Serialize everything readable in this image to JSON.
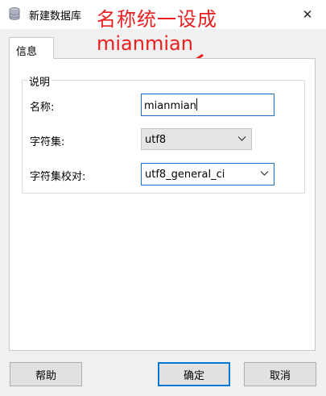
{
  "window": {
    "title": "新建数据库",
    "close_glyph": "✕"
  },
  "annotation": {
    "line1": "名称统一设成",
    "line2": "mianmian",
    "color": "#e8201f"
  },
  "tabs": [
    {
      "label": "信息",
      "active": true
    }
  ],
  "group": {
    "legend": "说明",
    "fields": {
      "name": {
        "label": "名称:",
        "value": "mianmian"
      },
      "charset": {
        "label": "字符集:",
        "value": "utf8"
      },
      "collation": {
        "label": "字符集校对:",
        "value": "utf8_general_ci"
      }
    }
  },
  "buttons": {
    "help": "帮助",
    "ok": "确定",
    "cancel": "取消"
  },
  "icons": {
    "title": "database-icon",
    "dropdown": "chevron-down-icon"
  },
  "colors": {
    "focus_border": "#1a6fc7",
    "default_button_border": "#0078d7"
  }
}
